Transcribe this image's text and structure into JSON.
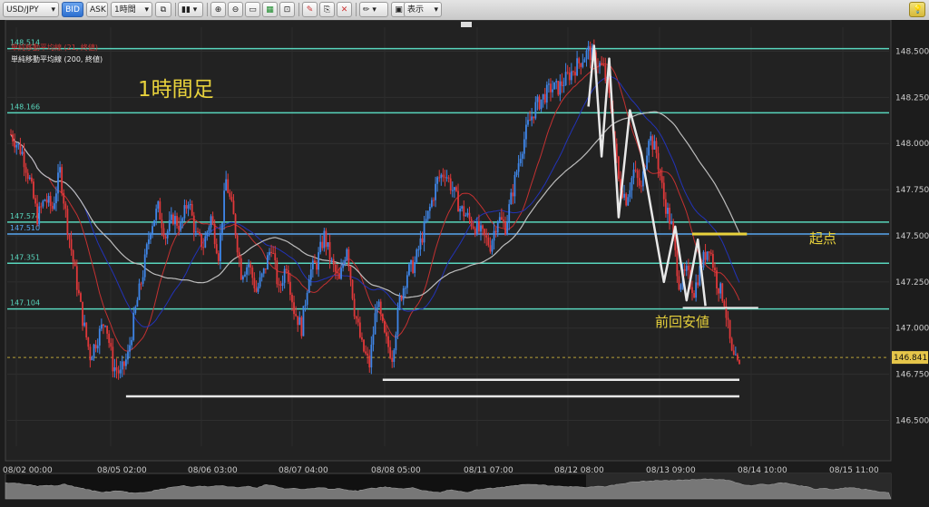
{
  "toolbar": {
    "symbol": "USD/JPY",
    "bid_label": "BID",
    "ask_label": "ASK",
    "timeframe": "1時間",
    "view_label": "表示"
  },
  "annotations": {
    "timeframe_title": "1時間足",
    "start_point": "起点",
    "prev_low": "前回安値"
  },
  "chart_data": {
    "type": "candlestick",
    "indicator_labels": [
      "単純移動平均線 (21, 終値)",
      "単純移動平均線 (200, 終値)"
    ],
    "y_ticks": [
      "148.500",
      "148.250",
      "148.000",
      "147.750",
      "147.500",
      "147.250",
      "147.000",
      "146.750",
      "146.500"
    ],
    "ylim": [
      146.36,
      148.63
    ],
    "x_ticks": [
      "08/02 00:00",
      "08/05 02:00",
      "08/06 03:00",
      "08/07 04:00",
      "08/08 05:00",
      "08/11 07:00",
      "08/12 08:00",
      "08/13 09:00",
      "08/14 10:00",
      "08/15 11:00"
    ],
    "current_price": "146.841",
    "horizontal_lines": [
      {
        "price": "148.514",
        "color": "#58d6bd"
      },
      {
        "price": "148.166",
        "color": "#58d6bd"
      },
      {
        "price": "147.574",
        "color": "#58d6bd"
      },
      {
        "price": "147.510",
        "color": "#58a6f0"
      },
      {
        "price": "147.351",
        "color": "#58d6bd"
      },
      {
        "price": "147.104",
        "color": "#58d6bd"
      }
    ],
    "close_path": [
      [
        0,
        148.05
      ],
      [
        6,
        147.95
      ],
      [
        10,
        147.8
      ],
      [
        14,
        147.6
      ],
      [
        18,
        147.7
      ],
      [
        22,
        147.65
      ],
      [
        26,
        147.85
      ],
      [
        30,
        147.55
      ],
      [
        34,
        147.3
      ],
      [
        38,
        147.05
      ],
      [
        42,
        146.85
      ],
      [
        46,
        146.95
      ],
      [
        50,
        147.05
      ],
      [
        54,
        146.8
      ],
      [
        58,
        146.75
      ],
      [
        62,
        146.85
      ],
      [
        66,
        147.1
      ],
      [
        70,
        147.3
      ],
      [
        74,
        147.55
      ],
      [
        78,
        147.65
      ],
      [
        82,
        147.5
      ],
      [
        86,
        147.6
      ],
      [
        90,
        147.55
      ],
      [
        94,
        147.7
      ],
      [
        98,
        147.5
      ],
      [
        102,
        147.45
      ],
      [
        106,
        147.6
      ],
      [
        110,
        147.4
      ],
      [
        114,
        147.8
      ],
      [
        118,
        147.6
      ],
      [
        122,
        147.3
      ],
      [
        126,
        147.35
      ],
      [
        130,
        147.2
      ],
      [
        134,
        147.3
      ],
      [
        138,
        147.45
      ],
      [
        142,
        147.2
      ],
      [
        146,
        147.35
      ],
      [
        150,
        147.1
      ],
      [
        154,
        147.0
      ],
      [
        158,
        147.3
      ],
      [
        162,
        147.35
      ],
      [
        166,
        147.5
      ],
      [
        170,
        147.35
      ],
      [
        174,
        147.25
      ],
      [
        178,
        147.45
      ],
      [
        182,
        147.1
      ],
      [
        186,
        146.9
      ],
      [
        190,
        146.8
      ],
      [
        194,
        147.15
      ],
      [
        198,
        146.95
      ],
      [
        202,
        146.85
      ],
      [
        206,
        147.15
      ],
      [
        210,
        147.3
      ],
      [
        214,
        147.35
      ],
      [
        218,
        147.5
      ],
      [
        222,
        147.65
      ],
      [
        226,
        147.8
      ],
      [
        230,
        147.85
      ],
      [
        234,
        147.75
      ],
      [
        238,
        147.65
      ],
      [
        242,
        147.6
      ],
      [
        246,
        147.55
      ],
      [
        250,
        147.5
      ],
      [
        254,
        147.45
      ],
      [
        258,
        147.6
      ],
      [
        262,
        147.55
      ],
      [
        266,
        147.75
      ],
      [
        270,
        147.95
      ],
      [
        274,
        148.1
      ],
      [
        278,
        148.2
      ],
      [
        282,
        148.25
      ],
      [
        286,
        148.3
      ],
      [
        290,
        148.3
      ],
      [
        294,
        148.35
      ],
      [
        298,
        148.4
      ],
      [
        302,
        148.45
      ],
      [
        306,
        148.5
      ],
      [
        310,
        148.45
      ],
      [
        314,
        148.4
      ],
      [
        318,
        148.2
      ],
      [
        322,
        147.8
      ],
      [
        326,
        147.7
      ],
      [
        330,
        147.85
      ],
      [
        334,
        147.75
      ],
      [
        338,
        148.05
      ],
      [
        342,
        147.95
      ],
      [
        346,
        147.7
      ],
      [
        350,
        147.55
      ],
      [
        354,
        147.25
      ],
      [
        358,
        147.3
      ],
      [
        362,
        147.2
      ],
      [
        366,
        147.35
      ],
      [
        370,
        147.45
      ],
      [
        374,
        147.25
      ],
      [
        378,
        147.15
      ],
      [
        382,
        146.85
      ],
      [
        386,
        146.78
      ]
    ]
  }
}
